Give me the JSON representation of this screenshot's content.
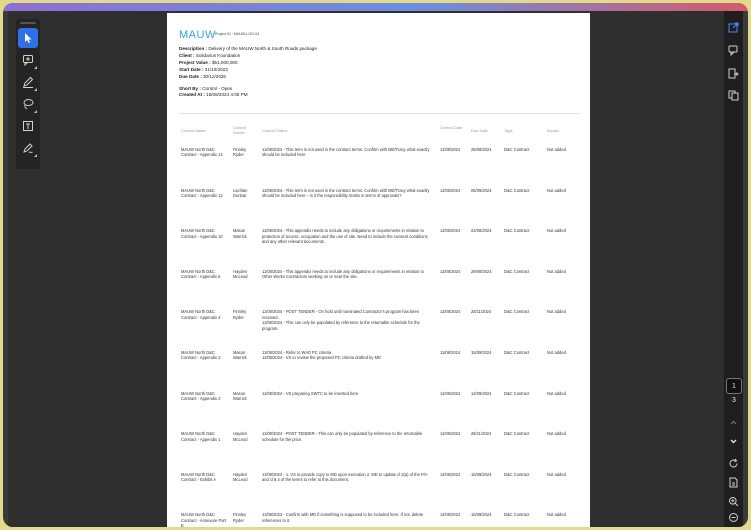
{
  "document": {
    "brand": "MAUW",
    "project_id": "Project ID : MAUW-LOG-04",
    "meta": [
      {
        "label": "Description :",
        "value": "Delivery of the MAUW North & South Roads package"
      },
      {
        "label": "Client :",
        "value": "Solidarius Foundation"
      },
      {
        "label": "Project Value :",
        "value": "$51,000,000"
      },
      {
        "label": "Start Date :",
        "value": "31/10/2023"
      },
      {
        "label": "Due Date :",
        "value": "30/12/2026"
      }
    ],
    "filters": [
      {
        "label": "Short By :",
        "value": "Control - Open"
      },
      {
        "label": "Created At :",
        "value": "15/08/2024 4:05 PM"
      }
    ],
    "columns": [
      "Control Name",
      "Control Owner",
      "Control Status",
      "Control Date",
      "Due Date",
      "Tags",
      "Impact"
    ],
    "rows": [
      {
        "name": "MAUW North D&C Contract - Appendix 14",
        "owner": "Finnley Ryder",
        "status": "11/08/2024 - This term is not used in the contract terms. Confirm with MD/Tracy what exactly should be included here",
        "date": "11/08/2024",
        "due": "29/08/2024",
        "tags": "D&C Contract",
        "impact": "Not added"
      },
      {
        "name": "MAUW North D&C Contract - Appendix 12",
        "owner": "Lachlan Dunbar",
        "status": "11/08/2024 - This term is not used in the contract terms. Confirm with MD/Tracy what exactly should be included here – is it the responsibility matrix in terms of approvals?",
        "date": "11/08/2024",
        "due": "05/09/2024",
        "tags": "D&C Contract",
        "impact": "Not added"
      },
      {
        "name": "MAUW North D&C Contract - Appendix 10",
        "owner": "Mason Warrick",
        "status": "11/08/2024 - This appendix needs to include any obligations or requirements in relation to protection of access, occupation and the use of site. Need to include the consent conditions and any other relevant documents.",
        "date": "11/08/2024",
        "due": "22/08/2024",
        "tags": "D&C Contract",
        "impact": "Not added"
      },
      {
        "name": "MAUW North D&C Contract - Appendix 6",
        "owner": "Hayden McLeod",
        "status": "11/08/2024 - This appendix needs to include any obligations or requirements in relation to Other Works Contractors working on or near the site.",
        "date": "11/08/2024",
        "due": "29/08/2024",
        "tags": "D&C Contract",
        "impact": "Not added"
      },
      {
        "name": "MAUW North D&C Contract - Appendix 4",
        "owner": "Finnley Ryder",
        "status": "11/08/2024 - POST TENDER - On hold until nominated Contractor's program has been received.\n11/08/2024 - This can only be populated by reference to the returnable schedule for the program.",
        "date": "11/08/2024",
        "due": "28/11/2024",
        "tags": "D&C Contract",
        "impact": "Not added"
      },
      {
        "name": "MAUW North D&C Contract - Appendix 3",
        "owner": "Mason Warrick",
        "status": "11/08/2024 - Refer to WAD PC criteria.\n11/08/2024 - VS to review the proposed PC criteria drafted by MD",
        "date": "11/08/2024",
        "due": "15/09/2024",
        "tags": "D&C Contract",
        "impact": "Not added"
      },
      {
        "name": "MAUW North D&C Contract - Appendix 2",
        "owner": "Mason Warrick",
        "status": "11/08/2024 - VS preparing SWTC to be inserted here",
        "date": "11/08/2024",
        "due": "12/09/2024",
        "tags": "D&C Contract",
        "impact": "Not added"
      },
      {
        "name": "MAUW North D&C Contract - Appendix 1",
        "owner": "Hayden McLeod",
        "status": "11/08/2024 - POST TENDER - This can only be populated by reference to the returnable schedule for the price.",
        "date": "11/08/2024",
        "due": "28/11/2024",
        "tags": "D&C Contract",
        "impact": "Not added"
      },
      {
        "name": "MAUW North D&C Contract - Exhibit A",
        "owner": "Hayden McLeod",
        "status": "11/08/2024 - 1. VS to provide copy to MD upon execution 2. MD to update cl 2(a) of the P/A and cl 8.4 of the terms to refer to this document.",
        "date": "11/08/2024",
        "due": "15/09/2024",
        "tags": "D&C Contract",
        "impact": "Not added"
      },
      {
        "name": "MAUW North D&C Contract - Annexure Part E",
        "owner": "Finnley Ryder",
        "status": "11/08/2024 - Confirm with MD if something is supposed to be included here. If not, delete references to it.",
        "date": "11/08/2024",
        "due": "15/09/2024",
        "tags": "D&C Contract",
        "impact": "Not added"
      }
    ]
  },
  "pager": {
    "current": "1",
    "total": "3"
  },
  "left_toolbar": [
    "select-pointer-icon",
    "comment-add-icon",
    "pen-draw-icon",
    "lasso-icon",
    "text-box-icon",
    "signature-icon"
  ],
  "right_toolbar": [
    "export-pdf-icon",
    "comment-icon",
    "share-icon",
    "copy-page-icon",
    "chevron-up-icon",
    "chevron-down-icon",
    "refresh-icon",
    "file-icon",
    "zoom-in-icon",
    "zoom-out-icon"
  ],
  "colors": {
    "accent": "#2f6fe8",
    "brand": "#3aa0d8",
    "export": "#4a8af4"
  }
}
